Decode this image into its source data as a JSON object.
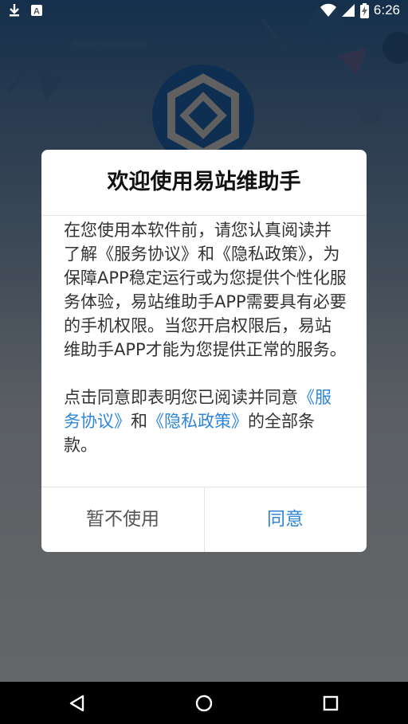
{
  "status_bar": {
    "time": "6:26",
    "icons": [
      "download-icon",
      "text-notification-icon",
      "wifi-icon",
      "signal-icon",
      "battery-charging-icon"
    ]
  },
  "dialog": {
    "title": "欢迎使用易站维助手",
    "para1": "在您使用本软件前，请您认真阅读并了解《服务协议》和《隐私政策》，为保障APP稳定运行或为您提供个性化服务体验，易站维助手APP需要具有必要的手机权限。当您开启权限后，易站维助手APP才能为您提供正常的服务。",
    "para2_prefix": "点击同意即表明您已阅读并同意",
    "link_service": "《服务协议》",
    "para2_and": "和",
    "link_privacy": "《隐私政策》",
    "para2_suffix": "的全部条款。",
    "decline_label": "暂不使用",
    "agree_label": "同意"
  },
  "nav_bar": {
    "icons": [
      "back-icon",
      "home-icon",
      "recents-icon"
    ]
  },
  "colors": {
    "link": "#2f86d6",
    "title": "#111111",
    "body_text": "#333333"
  }
}
